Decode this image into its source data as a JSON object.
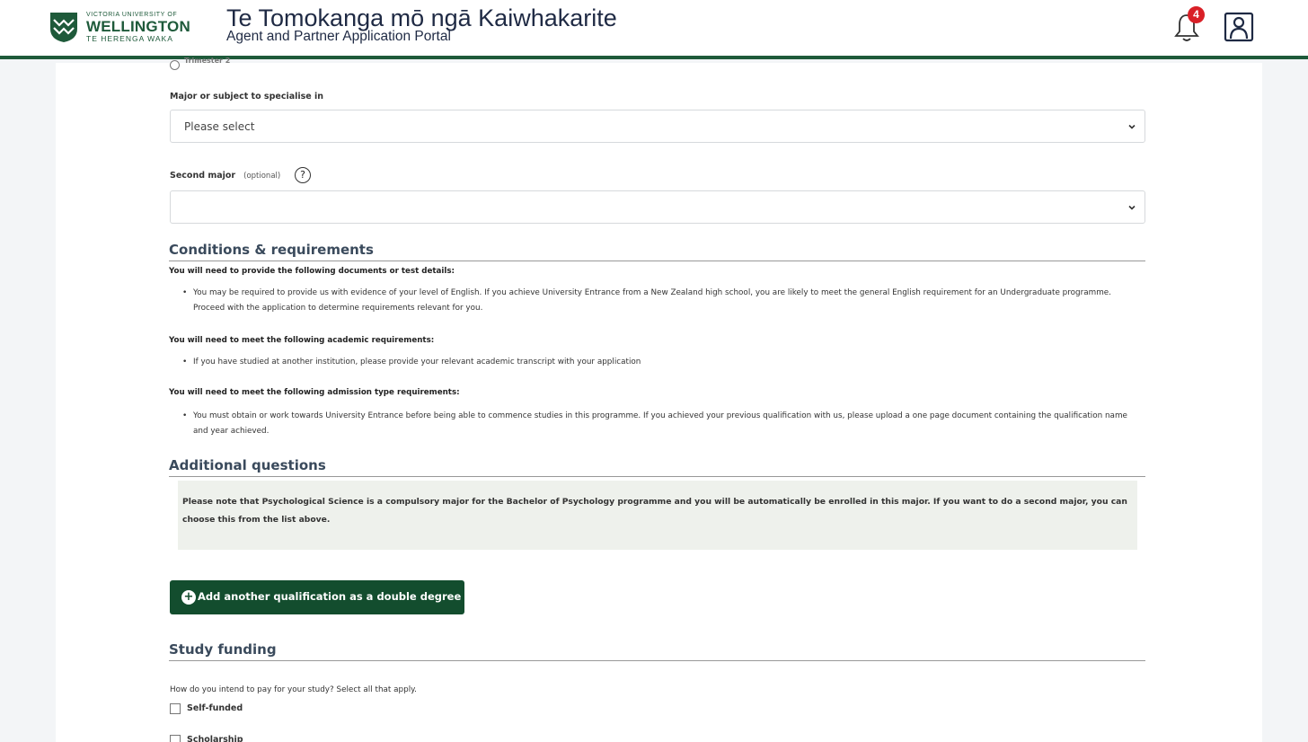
{
  "header": {
    "logo_top": "VICTORIA UNIVERSITY OF",
    "logo_main": "WELLINGTON",
    "logo_sub": "TE HERENGA WAKA",
    "title": "Te Tomokanga mō ngā Kaiwhakarite",
    "subtitle": "Agent and Partner Application Portal",
    "notification_count": "4",
    "icons": {
      "notification": "bell-icon",
      "profile": "user-profile-icon"
    },
    "colors": {
      "brand": "#1e5a3a",
      "badge": "#d92027"
    }
  },
  "form": {
    "partial_radio_label": "Trimester 2",
    "major_label": "Major or subject to specialise in",
    "major_value": "Please select",
    "second_major_label": "Second major",
    "second_major_optional": "(optional)",
    "second_major_value": "",
    "help_symbol": "?"
  },
  "conditions": {
    "heading": "Conditions & requirements",
    "documents_intro": "You will need to provide the following documents or test details:",
    "documents_items": [
      "You may be required to provide us with evidence of your level of English. If you achieve University Entrance from a New Zealand high school, you are likely to meet the general English requirement for an Undergraduate programme. Proceed with the application to determine requirements relevant for you."
    ],
    "academic_intro": "You will need to meet the following academic requirements:",
    "academic_items": [
      "If you have studied at another institution, please provide your relevant academic transcript with your application"
    ],
    "admission_intro": "You will need to meet the following admission type requirements:",
    "admission_items": [
      "You must obtain or work towards University Entrance before being able to commence studies in this programme. If you achieved your previous qualification with us, please upload a one page document containing the qualification name and year achieved."
    ]
  },
  "additional": {
    "heading": "Additional questions",
    "note": "Please note that Psychological Science is a compulsory major for the Bachelor of Psychology programme and you will be automatically be enrolled in this major. If you want to do a second major, you can choose this from the list above."
  },
  "double_degree_button": "Add another qualification as a double degree",
  "funding": {
    "heading": "Study funding",
    "question": "How do you intend to pay for your study? Select all that apply.",
    "options": [
      "Self-funded",
      "Scholarship"
    ]
  }
}
